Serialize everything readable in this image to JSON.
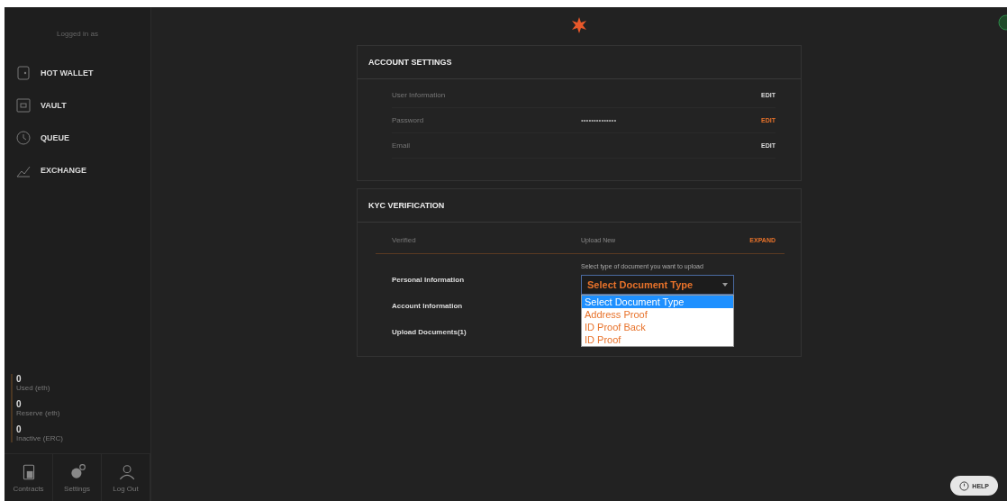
{
  "sidebar": {
    "user_label": "Logged in as",
    "nav": [
      {
        "label": "HOT WALLET"
      },
      {
        "label": "VAULT"
      },
      {
        "label": "QUEUE"
      },
      {
        "label": "EXCHANGE"
      }
    ],
    "stats": [
      {
        "value": "0",
        "label": "Used (eth)"
      },
      {
        "value": "0",
        "label": "Reserve (eth)"
      },
      {
        "value": "0",
        "label": "Inactive (ERC)"
      }
    ],
    "buttons": [
      {
        "label": "Contracts"
      },
      {
        "label": "Settings"
      },
      {
        "label": "Log Out"
      }
    ]
  },
  "account_settings": {
    "title": "ACCOUNT SETTINGS",
    "rows": [
      {
        "label": "User Information",
        "action": "EDIT",
        "highlighted": false
      },
      {
        "label": "Password",
        "value": "••••••••••••••",
        "action": "EDIT",
        "highlighted": true
      },
      {
        "label": "Email",
        "action": "EDIT",
        "highlighted": false
      }
    ]
  },
  "kyc": {
    "title": "KYC VERIFICATION",
    "status": "Verified",
    "link": "Upload New",
    "action": "EXPAND",
    "steps": [
      "Personal Information",
      "Account Information",
      "Upload Documents(1)"
    ],
    "hint": "Select type of document you want to upload",
    "select": {
      "value": "Select Document Type",
      "open": true,
      "options": [
        {
          "label": "Select Document Type",
          "selected": true
        },
        {
          "label": "Address Proof",
          "selected": false
        },
        {
          "label": "ID Proof Back",
          "selected": false
        },
        {
          "label": "ID Proof",
          "selected": false
        }
      ]
    }
  },
  "help": "HELP"
}
